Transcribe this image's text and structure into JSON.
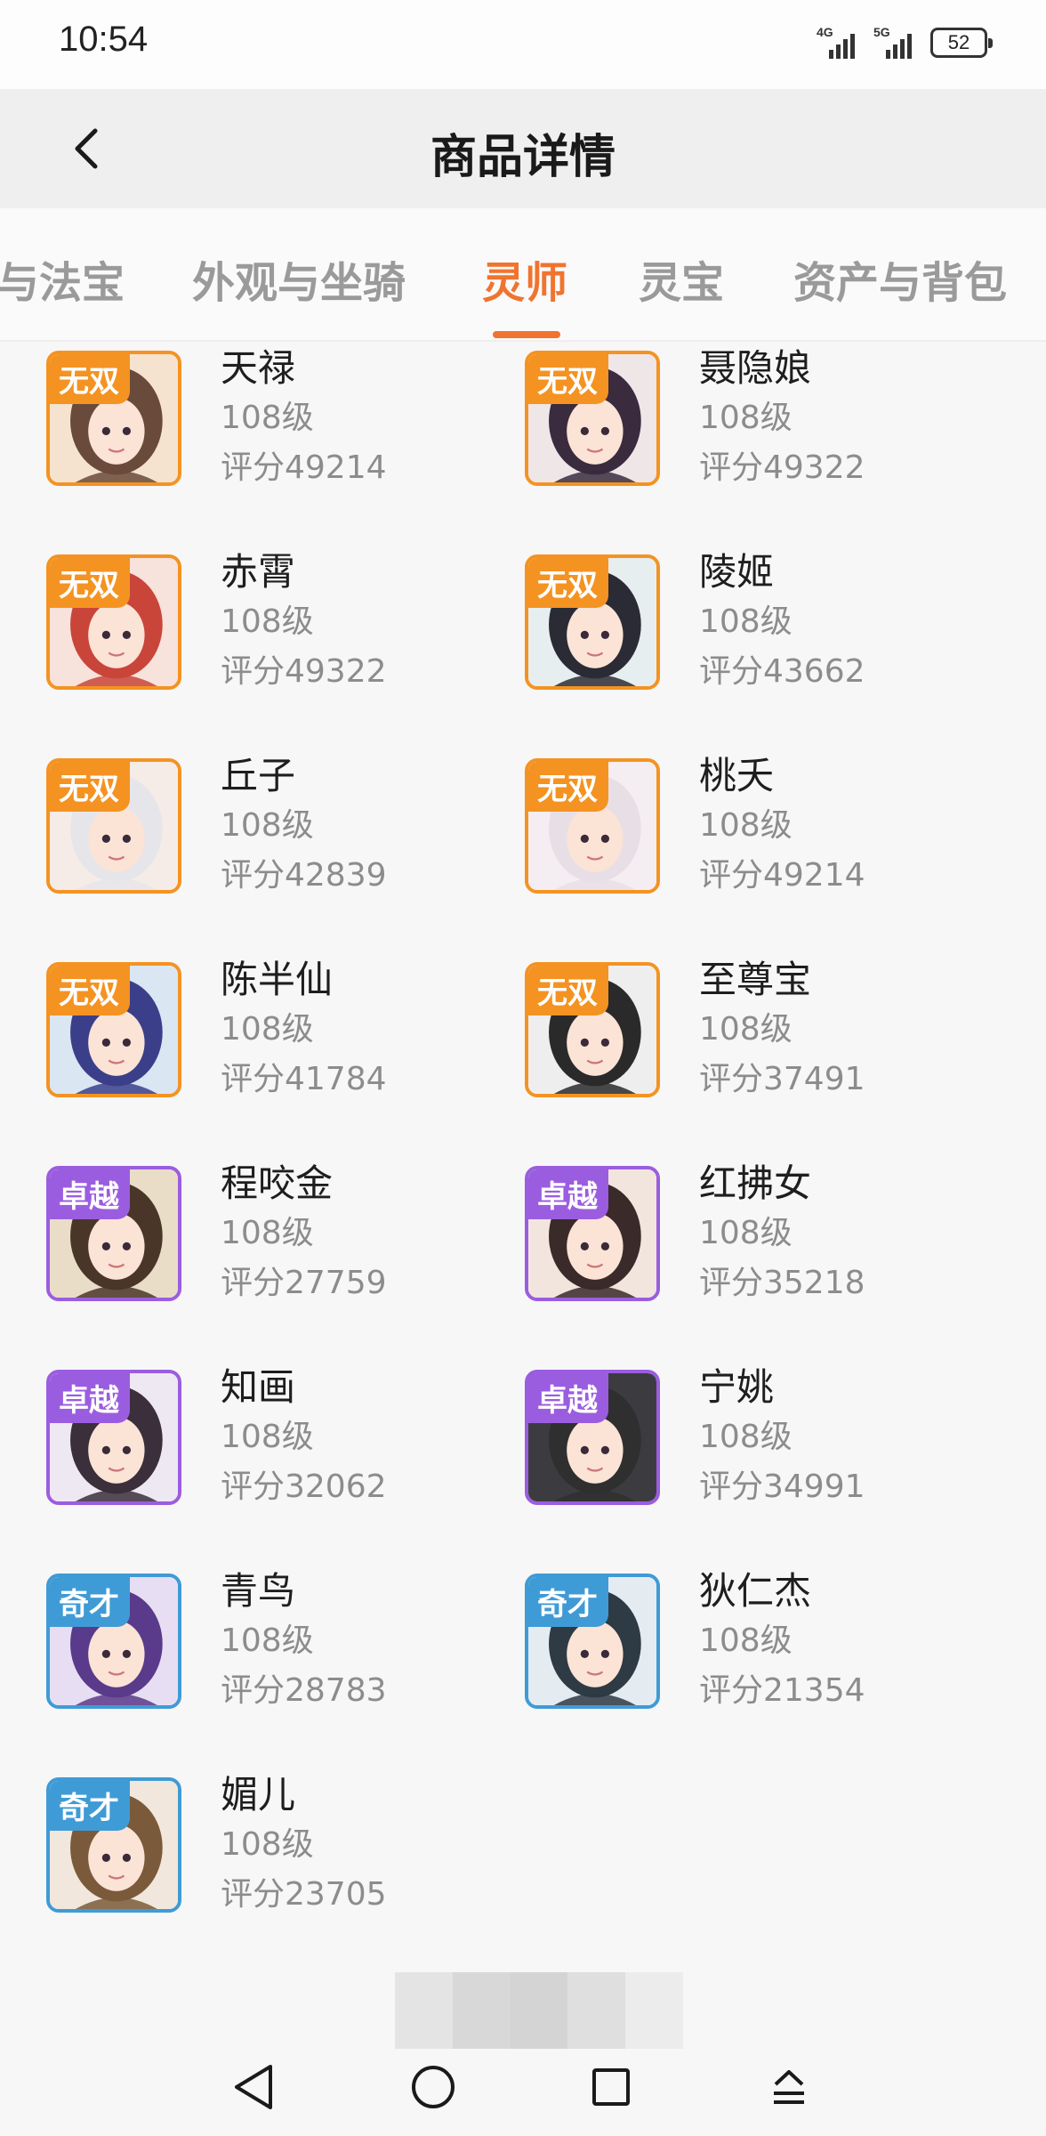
{
  "status_bar": {
    "time": "10:54",
    "net1": "4G",
    "net2": "5G",
    "battery": "52"
  },
  "header": {
    "title": "商品详情"
  },
  "tabs": [
    {
      "label": "与法宝",
      "active": false
    },
    {
      "label": "外观与坐骑",
      "active": false
    },
    {
      "label": "灵师",
      "active": true
    },
    {
      "label": "灵宝",
      "active": false
    },
    {
      "label": "资产与背包",
      "active": false
    }
  ],
  "colors": {
    "accent": "#f0742f",
    "badge_wushuang": "#f49322",
    "badge_zhuoyue": "#9b5de0",
    "badge_qicai": "#3f9bd6"
  },
  "characters": [
    {
      "name": "天禄",
      "level": "108级",
      "score": "评分49214",
      "badge": "无双"
    },
    {
      "name": "聂隐娘",
      "level": "108级",
      "score": "评分49322",
      "badge": "无双"
    },
    {
      "name": "赤霄",
      "level": "108级",
      "score": "评分49322",
      "badge": "无双"
    },
    {
      "name": "陵姬",
      "level": "108级",
      "score": "评分43662",
      "badge": "无双"
    },
    {
      "name": "丘子",
      "level": "108级",
      "score": "评分42839",
      "badge": "无双"
    },
    {
      "name": "桃夭",
      "level": "108级",
      "score": "评分49214",
      "badge": "无双"
    },
    {
      "name": "陈半仙",
      "level": "108级",
      "score": "评分41784",
      "badge": "无双"
    },
    {
      "name": "至尊宝",
      "level": "108级",
      "score": "评分37491",
      "badge": "无双"
    },
    {
      "name": "程咬金",
      "level": "108级",
      "score": "评分27759",
      "badge": "卓越"
    },
    {
      "name": "红拂女",
      "level": "108级",
      "score": "评分35218",
      "badge": "卓越"
    },
    {
      "name": "知画",
      "level": "108级",
      "score": "评分32062",
      "badge": "卓越"
    },
    {
      "name": "宁姚",
      "level": "108级",
      "score": "评分34991",
      "badge": "卓越"
    },
    {
      "name": "青鸟",
      "level": "108级",
      "score": "评分28783",
      "badge": "奇才"
    },
    {
      "name": "狄仁杰",
      "level": "108级",
      "score": "评分21354",
      "badge": "奇才"
    },
    {
      "name": "媚儿",
      "level": "108级",
      "score": "评分23705",
      "badge": "奇才"
    }
  ],
  "navbar": [
    "back-triangle-icon",
    "home-circle-icon",
    "recents-square-icon",
    "menu-up-icon"
  ]
}
